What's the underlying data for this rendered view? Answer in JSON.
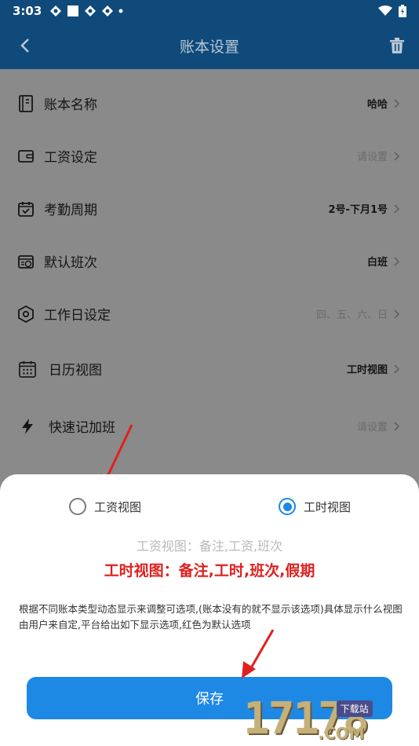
{
  "status_bar": {
    "time": "3:03"
  },
  "app_bar": {
    "title": "账本设置"
  },
  "settings": [
    {
      "icon": "ledger-icon",
      "label": "账本名称",
      "value": "哈哈",
      "placeholder": false
    },
    {
      "icon": "wallet-icon",
      "label": "工资设定",
      "value": "请设置",
      "placeholder": true
    },
    {
      "icon": "calendar-check-icon",
      "label": "考勤周期",
      "value": "2号-下月1号",
      "placeholder": false
    },
    {
      "icon": "shift-icon",
      "label": "默认班次",
      "value": "白班",
      "placeholder": false
    },
    {
      "icon": "hexagon-gear-icon",
      "label": "工作日设定",
      "value": "四、五、六、日",
      "placeholder": true
    },
    {
      "icon": "calendar-grid-icon",
      "label": "日历视图",
      "value": "工时视图",
      "placeholder": false
    },
    {
      "icon": "lightning-icon",
      "label": "快速记加班",
      "value": "请设置",
      "placeholder": true
    }
  ],
  "sheet": {
    "option_salary": "工资视图",
    "option_hours": "工时视图",
    "selected": "工时视图",
    "hint_salary": "工资视图：备注,工资,班次",
    "hint_hours": "工时视图：备注,工时,班次,假期",
    "description": "根据不同账本类型动态显示来调整可选项,(账本没有的就不显示该选项)具体显示什么视图由用户来自定,平台给出如下显示选项,红色为默认选项",
    "save_label": "保存"
  },
  "watermark": {
    "number": "17178",
    "badge": "下载站",
    "suffix": ".COM"
  },
  "colors": {
    "header": "#0f4a7a",
    "accent": "#1e88e5",
    "red": "#e0201f",
    "overlay": "#8a8a8a"
  }
}
